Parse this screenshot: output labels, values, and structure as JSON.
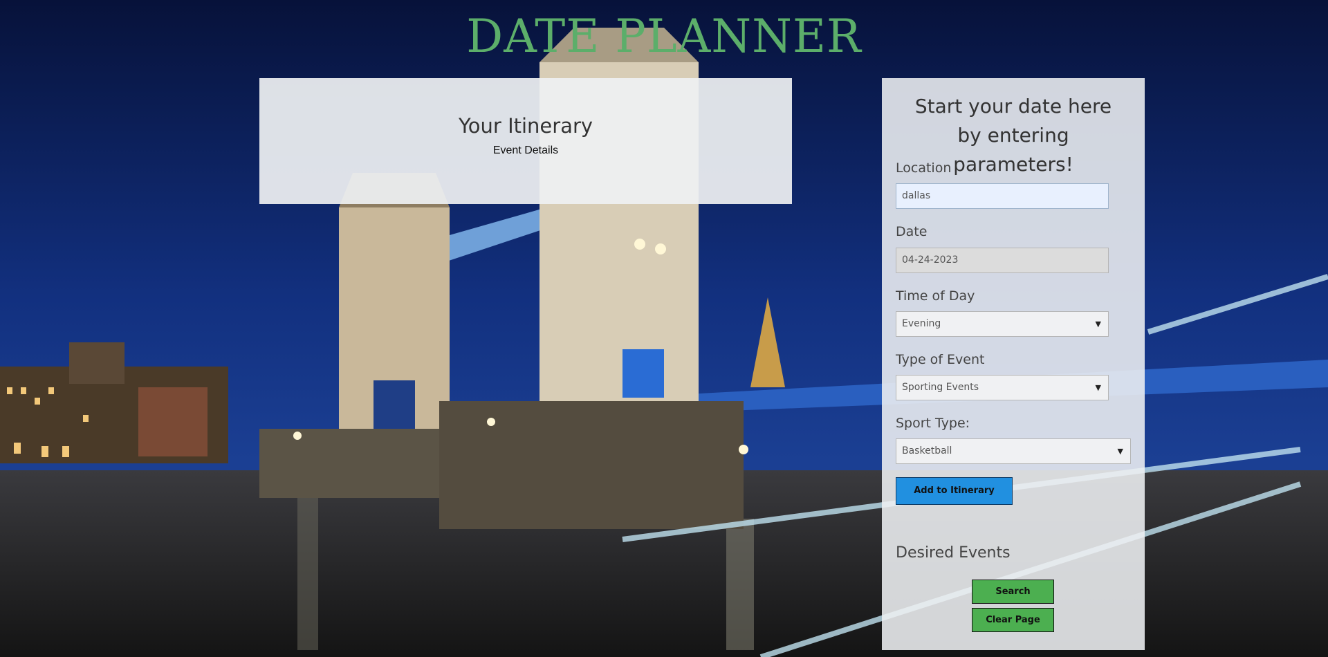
{
  "header": {
    "title": "DATE PLANNER"
  },
  "itinerary": {
    "title": "Your Itinerary",
    "details": "Event Details"
  },
  "form": {
    "heading": "Start your date here by entering parameters!",
    "location": {
      "label": "Location",
      "value": "dallas"
    },
    "date": {
      "label": "Date",
      "value": "04-24-2023"
    },
    "time_of_day": {
      "label": "Time of Day",
      "selected": "Evening"
    },
    "event_type": {
      "label": "Type of Event",
      "selected": "Sporting Events"
    },
    "sport_type": {
      "label": "Sport Type:",
      "selected": "Basketball"
    },
    "add_button": "Add to Itinerary",
    "desired_events": "Desired Events",
    "search_button": "Search",
    "clear_button": "Clear Page"
  },
  "icons": {
    "dropdown": "caret-down-icon"
  },
  "colors": {
    "title": "#5cae6a",
    "primary_button": "#2190e0",
    "secondary_button": "#4caf50"
  }
}
